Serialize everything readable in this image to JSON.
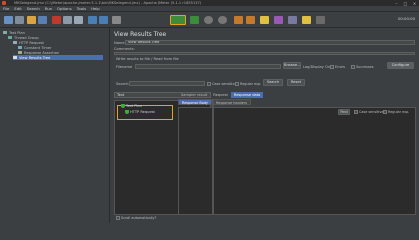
{
  "window": {
    "title": "MKSelegend.jmx (C:\\jMeter\\apache-jmeter-5.1.1\\bin\\MKSelegend.jmx) - Apache JMeter (5.1.1 r1855137)"
  },
  "menu": [
    "File",
    "Edit",
    "Search",
    "Run",
    "Options",
    "Tools",
    "Help"
  ],
  "toolbar": {
    "timer": "00:00:00"
  },
  "tree": {
    "items": [
      "Test Plan",
      "Thread Group",
      "HTTP Request",
      "Constant Timer",
      "Response Assertion",
      "View Results Tree"
    ],
    "selected": "View Results Tree"
  },
  "panel": {
    "title": "View Results Tree",
    "name_label": "Name:",
    "name_value": "View Results Tree",
    "comments_label": "Comments:",
    "file_section": "Write results to file / Read from file",
    "filename_label": "Filename",
    "browse": "Browse...",
    "log_errors": "Log/Display Only:",
    "errors": "Errors",
    "successes": "Successes",
    "configure": "Configure",
    "search_label": "Search:",
    "case_sensitive": "Case sensitive",
    "regexp": "Regular exp.",
    "search_btn": "Search",
    "reset_btn": "Reset",
    "text_select": "Text",
    "results": [
      "Test Plan",
      "HTTP Request"
    ],
    "tabs": [
      "Sampler result",
      "Request",
      "Response data"
    ],
    "active_tab": "Response data",
    "subtabs": [
      "Response Body",
      "Response headers"
    ],
    "find_btn": "Find",
    "case_sensitive2": "Case sensitive",
    "regexp2": "Regular exp.",
    "scroll": "Scroll automatically?"
  }
}
